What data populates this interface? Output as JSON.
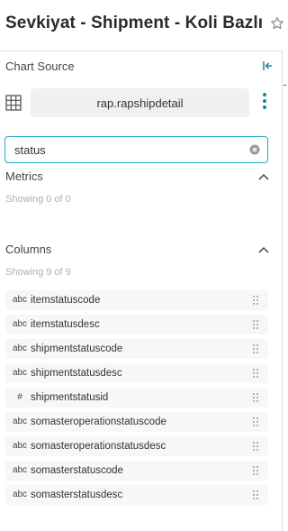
{
  "header": {
    "title": "Sevkiyat - Shipment - Koli Bazlı",
    "favorite_icon": "star-icon"
  },
  "datasource": {
    "header": "Chart Source",
    "collapse_icon": "collapse-left-icon",
    "type_icon": "table-grid-icon",
    "name": "rap.rapshipdetail",
    "more_icon": "vertical-dots-icon"
  },
  "search": {
    "value": "status",
    "clear_icon": "clear-circle-icon"
  },
  "metrics": {
    "title": "Metrics",
    "showing": "Showing 0 of 0",
    "expanded": true
  },
  "columns": {
    "title": "Columns",
    "showing": "Showing 9 of 9",
    "expanded": true,
    "items": [
      {
        "type": "abc",
        "name": "itemstatuscode"
      },
      {
        "type": "abc",
        "name": "itemstatusdesc"
      },
      {
        "type": "abc",
        "name": "shipmentstatuscode"
      },
      {
        "type": "abc",
        "name": "shipmentstatusdesc"
      },
      {
        "type": "#",
        "name": "shipmentstatusid"
      },
      {
        "type": "abc",
        "name": "somasteroperationstatuscode"
      },
      {
        "type": "abc",
        "name": "somasteroperationstatusdesc"
      },
      {
        "type": "abc",
        "name": "somasterstatuscode"
      },
      {
        "type": "abc",
        "name": "somasterstatusdesc"
      }
    ]
  },
  "colors": {
    "accent": "#20a7c9",
    "item_bg": "#f7f7f7",
    "muted_text": "#b0b0b0"
  }
}
